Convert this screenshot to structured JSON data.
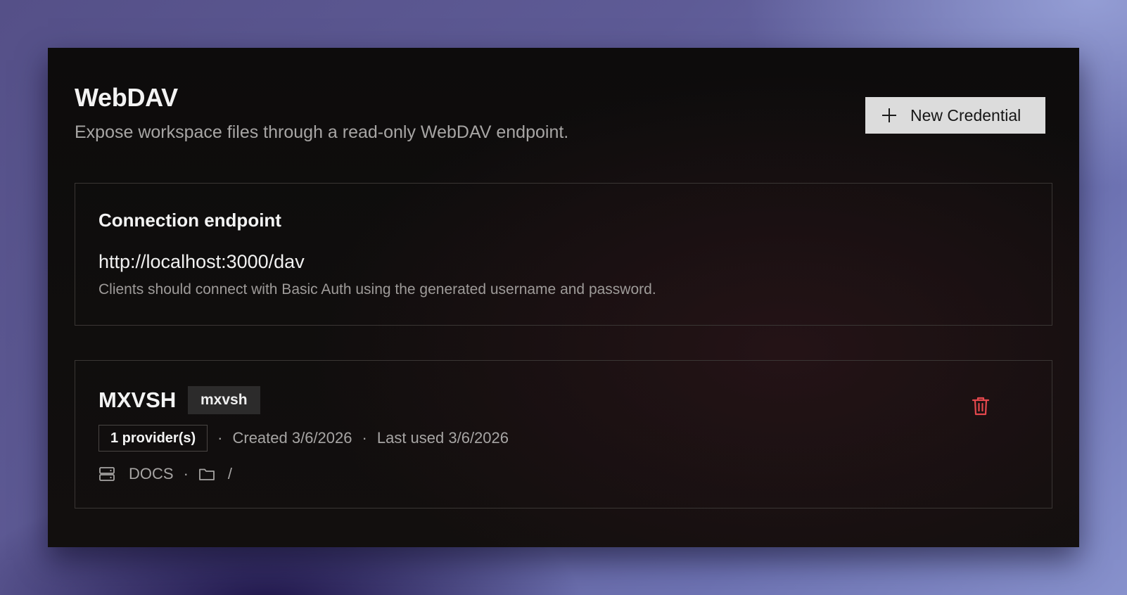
{
  "header": {
    "title": "WebDAV",
    "subtitle": "Expose workspace files through a read-only WebDAV endpoint.",
    "new_credential_label": "New Credential"
  },
  "endpoint": {
    "heading": "Connection endpoint",
    "url": "http://localhost:3000/dav",
    "help": "Clients should connect with Basic Auth using the generated username and password."
  },
  "credential": {
    "name": "MXVSH",
    "username": "mxvsh",
    "providers": "1 provider(s)",
    "separator": "·",
    "created": "Created 3/6/2026",
    "last_used": "Last used 3/6/2026",
    "provider_name": "DOCS",
    "path": "/"
  },
  "icons": {
    "add": "plus-icon",
    "delete": "trash-icon",
    "provider": "server-icon",
    "path": "folder-icon"
  },
  "colors": {
    "danger": "#e5484d",
    "button_bg": "#dcdcdc",
    "panel_bg": "#0f0d0d"
  }
}
